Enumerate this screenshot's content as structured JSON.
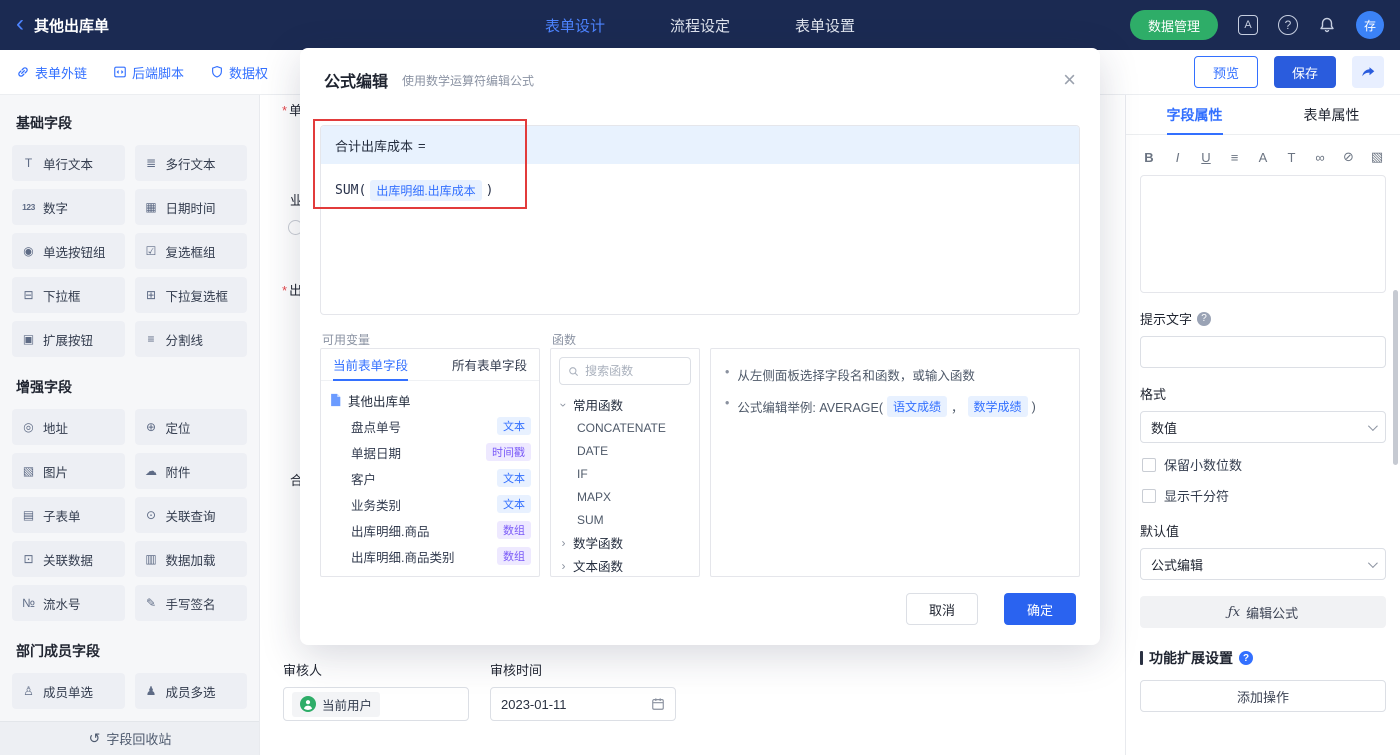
{
  "colors": {
    "accent": "#3370ff",
    "deep_blue": "#2a5cdd",
    "navy_bar": "#1b2a52",
    "green": "#2ead68",
    "annotation_red": "#e23b3b",
    "tag_blue": "#3370ff",
    "tag_purple": "#7a5af8"
  },
  "topbar": {
    "back_icon": "‹",
    "title": "其他出库单",
    "tabs": [
      {
        "label": "表单设计"
      },
      {
        "label": "流程设定"
      },
      {
        "label": "表单设置"
      }
    ],
    "data_manage_button": "数据管理",
    "translate_icon_letter": "A",
    "help_icon": "?",
    "avatar_text": "存"
  },
  "toolbar": {
    "links": [
      {
        "label": "表单外链"
      },
      {
        "label": "后端脚本"
      },
      {
        "label": "数据权"
      }
    ],
    "preview_button": "预览",
    "save_button": "保存"
  },
  "sidebar": {
    "sections": [
      {
        "title": "基础字段",
        "fields": [
          {
            "label": "单行文本",
            "glyph": "T"
          },
          {
            "label": "多行文本",
            "glyph": "≣"
          },
          {
            "label": "数字",
            "glyph": "123"
          },
          {
            "label": "日期时间",
            "glyph": "▦"
          },
          {
            "label": "单选按钮组",
            "glyph": "◉"
          },
          {
            "label": "复选框组",
            "glyph": "☑"
          },
          {
            "label": "下拉框",
            "glyph": "⊟"
          },
          {
            "label": "下拉复选框",
            "glyph": "⊞"
          },
          {
            "label": "扩展按钮",
            "glyph": "▣"
          },
          {
            "label": "分割线",
            "glyph": "≡"
          }
        ]
      },
      {
        "title": "增强字段",
        "fields": [
          {
            "label": "地址",
            "glyph": "◎"
          },
          {
            "label": "定位",
            "glyph": "⊕"
          },
          {
            "label": "图片",
            "glyph": "▧"
          },
          {
            "label": "附件",
            "glyph": "☁"
          },
          {
            "label": "子表单",
            "glyph": "▤"
          },
          {
            "label": "关联查询",
            "glyph": "⊙"
          },
          {
            "label": "关联数据",
            "glyph": "⊡"
          },
          {
            "label": "数据加载",
            "glyph": "▥"
          },
          {
            "label": "流水号",
            "glyph": "№"
          },
          {
            "label": "手写签名",
            "glyph": "✎"
          }
        ]
      },
      {
        "title": "部门成员字段",
        "fields": [
          {
            "label": "成员单选",
            "glyph": "♙"
          },
          {
            "label": "成员多选",
            "glyph": "♟"
          }
        ]
      }
    ],
    "recycle_icon": "↺",
    "recycle_bin": "字段回收站"
  },
  "canvas": {
    "fragments": [
      {
        "star": "*",
        "text": "单"
      },
      {
        "star": "",
        "text": "业"
      },
      {
        "star": "*",
        "text": "出"
      },
      {
        "star": "",
        "text": "合"
      }
    ],
    "reviewer_label": "审核人",
    "reviewer_value": "当前用户",
    "review_time_label": "审核时间",
    "review_time_value": "2023-01-11"
  },
  "modal": {
    "title": "公式编辑",
    "subtitle": "使用数学运算符编辑公式",
    "close_icon": "×",
    "formula": {
      "target": "合计出库成本",
      "equals": "=",
      "func_open": "SUM(",
      "field_tag": "出库明细.出库成本",
      "func_close": ")"
    },
    "variables": {
      "label": "可用变量",
      "tabs": [
        {
          "label": "当前表单字段"
        },
        {
          "label": "所有表单字段"
        }
      ],
      "root": "其他出库单",
      "fields": [
        {
          "name": "盘点单号",
          "type": "文本"
        },
        {
          "name": "单据日期",
          "type": "时间戳"
        },
        {
          "name": "客户",
          "type": "文本"
        },
        {
          "name": "业务类别",
          "type": "文本"
        },
        {
          "name": "出库明细.商品",
          "type": "数组"
        },
        {
          "name": "出库明细.商品类别",
          "type": "数组"
        }
      ]
    },
    "functions": {
      "label": "函数",
      "search_placeholder": "搜索函数",
      "groups": [
        {
          "name": "常用函数"
        },
        {
          "name": "数学函数"
        },
        {
          "name": "文本函数"
        }
      ],
      "common_items": [
        "CONCATENATE",
        "DATE",
        "IF",
        "MAPX",
        "SUM"
      ]
    },
    "help": {
      "line1": "从左侧面板选择字段名和函数，或输入函数",
      "line2_prefix": "公式编辑举例: AVERAGE(",
      "tag1": "语文成绩",
      "separator": "，",
      "tag2": "数学成绩",
      "line2_suffix": ")"
    },
    "cancel_button": "取消",
    "confirm_button": "确定"
  },
  "panel": {
    "tabs": [
      {
        "label": "字段属性"
      },
      {
        "label": "表单属性"
      }
    ],
    "rt_icons": [
      "B",
      "I",
      "U",
      "≡",
      "A",
      "T",
      "∞",
      "⊘",
      "▧"
    ],
    "hint_label": "提示文字",
    "hint_help_icon": "?",
    "format_label": "格式",
    "format_value": "数值",
    "decimal_checkbox": "保留小数位数",
    "thousand_checkbox": "显示千分符",
    "default_label": "默认值",
    "default_value": "公式编辑",
    "fx_prefix": "ƒx",
    "edit_formula_button": "编辑公式",
    "extension_label": "功能扩展设置",
    "extension_help_icon": "?",
    "add_action_button": "添加操作"
  }
}
